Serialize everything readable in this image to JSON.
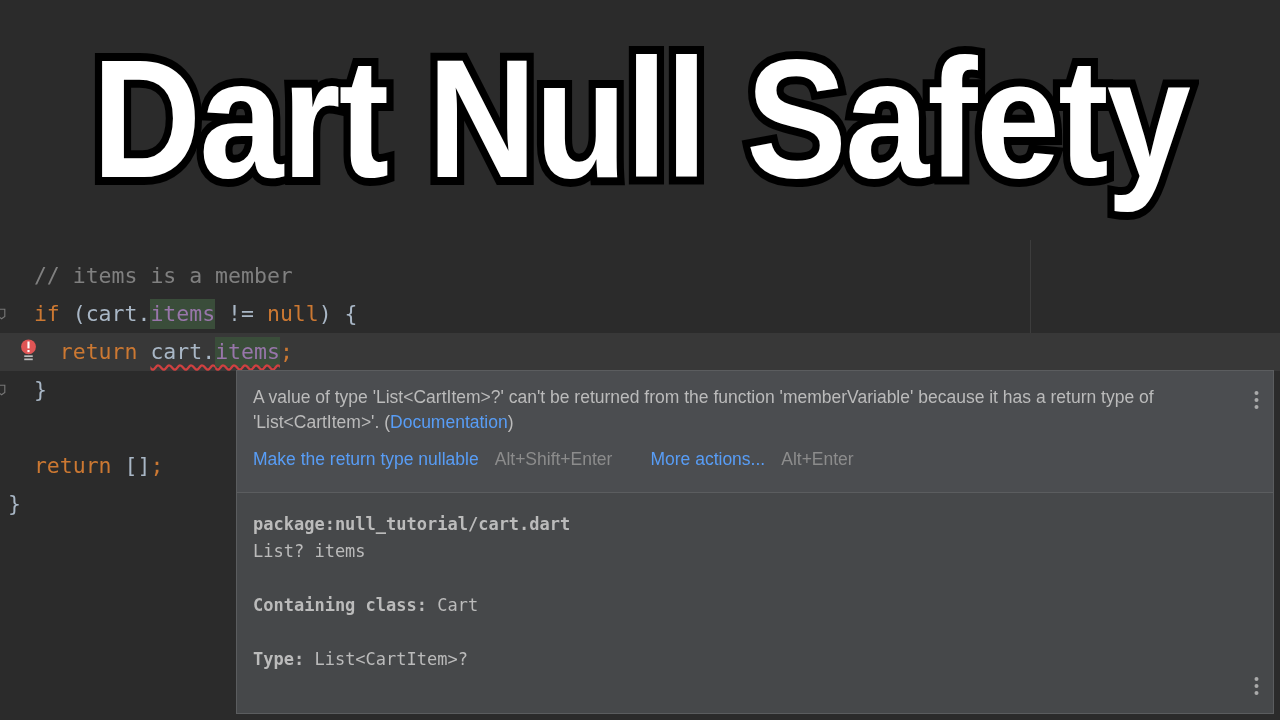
{
  "title": "Dart Null Safety",
  "code_lines": [
    {
      "current": false,
      "error": false,
      "fold": false,
      "tokens": [
        {
          "text": "  // items is a member",
          "kind": "comment",
          "highlight": false,
          "underline": false
        }
      ]
    },
    {
      "current": false,
      "error": false,
      "fold": true,
      "tokens": [
        {
          "text": "  if",
          "kind": "keyword",
          "highlight": false,
          "underline": false
        },
        {
          "text": " (cart.",
          "kind": "text",
          "highlight": false,
          "underline": false
        },
        {
          "text": "items",
          "kind": "field",
          "highlight": true,
          "underline": false
        },
        {
          "text": " != ",
          "kind": "text",
          "highlight": false,
          "underline": false
        },
        {
          "text": "null",
          "kind": "keyword",
          "highlight": false,
          "underline": false
        },
        {
          "text": ") {",
          "kind": "text",
          "highlight": false,
          "underline": false
        }
      ]
    },
    {
      "current": true,
      "error": true,
      "fold": false,
      "tokens": [
        {
          "text": "    return ",
          "kind": "keyword",
          "highlight": false,
          "underline": false
        },
        {
          "text": "cart.",
          "kind": "text",
          "highlight": false,
          "underline": true
        },
        {
          "text": "items",
          "kind": "field",
          "highlight": true,
          "underline": true
        },
        {
          "text": ";",
          "kind": "keyword",
          "highlight": false,
          "underline": false
        }
      ]
    },
    {
      "current": false,
      "error": false,
      "fold": true,
      "tokens": [
        {
          "text": "  }",
          "kind": "text",
          "highlight": false,
          "underline": false
        }
      ]
    },
    {
      "current": false,
      "error": false,
      "fold": false
    },
    {
      "current": false,
      "error": false,
      "fold": false,
      "tokens": [
        {
          "text": "  return",
          "kind": "keyword",
          "highlight": false,
          "underline": false
        },
        {
          "text": " []",
          "kind": "text",
          "highlight": false,
          "underline": false
        },
        {
          "text": ";",
          "kind": "keyword",
          "highlight": false,
          "underline": false
        }
      ]
    },
    {
      "current": false,
      "error": false,
      "fold": false,
      "tokens": [
        {
          "text": "}",
          "kind": "text",
          "highlight": false,
          "underline": false
        }
      ]
    }
  ],
  "popup": {
    "message_before": "A value of type 'List<CartItem>?' can't be returned from the function 'memberVariable' because it has a return type of 'List<CartItem>'. (",
    "message_link": "Documentation",
    "message_after": ")",
    "actions": [
      {
        "label": "Make the return type nullable",
        "shortcut": "Alt+Shift+Enter"
      },
      {
        "label": "More actions...",
        "shortcut": "Alt+Enter"
      }
    ],
    "doc_sections": [
      [
        "**package:null_tutorial/cart.dart**",
        "List? items"
      ],
      [
        "**Containing class:** Cart"
      ],
      [
        "**Type:** List<CartItem>?"
      ]
    ]
  }
}
